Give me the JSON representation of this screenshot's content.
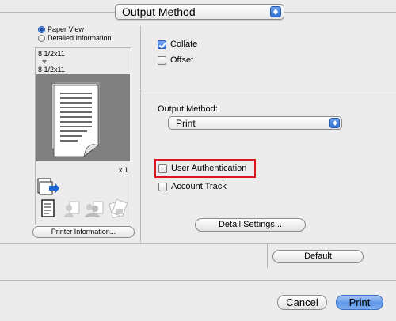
{
  "header": {
    "popup_label": "Output Method"
  },
  "preview": {
    "view_options": [
      {
        "label": "Paper View",
        "selected": true
      },
      {
        "label": "Detailed Information",
        "selected": false
      }
    ],
    "paper_size_top": "8 1/2x11",
    "paper_size_bottom": "8 1/2x11",
    "count": "x 1",
    "printer_info_label": "Printer Information..."
  },
  "options": {
    "collate": {
      "label": "Collate",
      "checked": true
    },
    "offset": {
      "label": "Offset",
      "checked": false
    },
    "output_method_label": "Output Method:",
    "output_method_value": "Print",
    "user_authentication": {
      "label": "User Authentication",
      "checked": false
    },
    "account_track": {
      "label": "Account Track",
      "checked": false
    },
    "detail_settings_label": "Detail Settings..."
  },
  "footer": {
    "default_label": "Default",
    "cancel_label": "Cancel",
    "print_label": "Print"
  },
  "colors": {
    "highlight": "#e0141e",
    "accent": "#3573d8"
  }
}
